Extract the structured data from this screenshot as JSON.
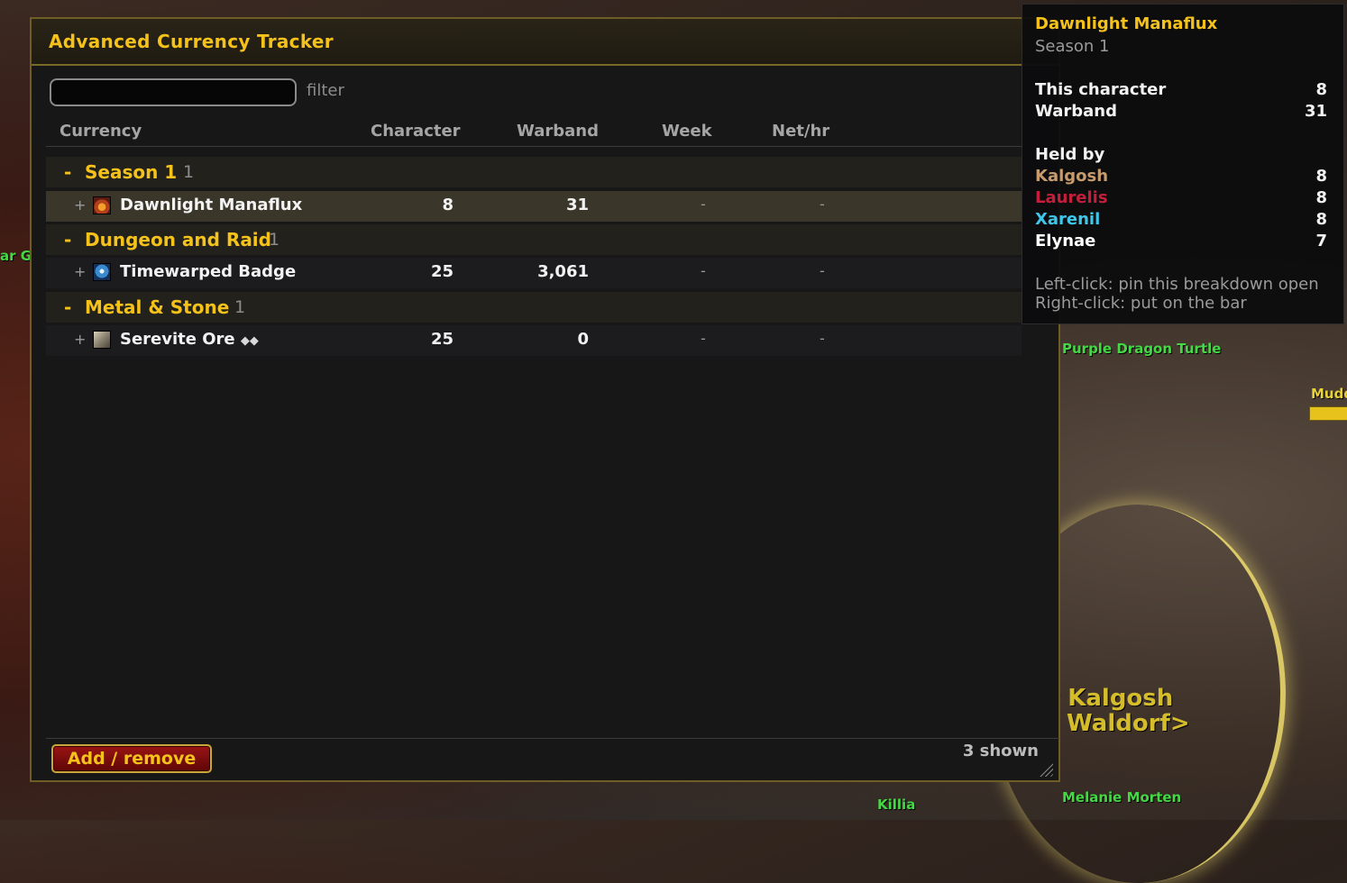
{
  "window": {
    "title": "Advanced Currency Tracker",
    "filter_label": "filter",
    "filter_value": "",
    "columns": [
      "Currency",
      "Character",
      "Warband",
      "Week",
      "Net/hr"
    ],
    "categories": [
      {
        "name": "Season 1",
        "count": "1",
        "items": [
          {
            "name": "Dawnlight Manaflux",
            "character": "8",
            "warband": "31",
            "week": "-",
            "net": "-",
            "icon": "manaflux-icon"
          }
        ]
      },
      {
        "name": "Dungeon and Raid",
        "count": "1",
        "items": [
          {
            "name": "Timewarped Badge",
            "character": "25",
            "warband": "3,061",
            "week": "-",
            "net": "-",
            "icon": "badge-icon"
          }
        ]
      },
      {
        "name": "Metal & Stone",
        "count": "1",
        "items": [
          {
            "name": "Serevite Ore",
            "quality": "◆◆",
            "character": "25",
            "warband": "0",
            "week": "-",
            "net": "-",
            "icon": "ore-icon"
          }
        ]
      }
    ],
    "add_button": "Add / remove",
    "shown_count": "3 shown"
  },
  "tooltip": {
    "title": "Dawnlight Manaflux",
    "subtitle": "Season 1",
    "this_character_label": "This character",
    "this_character_value": "8",
    "warband_label": "Warband",
    "warband_value": "31",
    "held_by_label": "Held by",
    "holders": [
      {
        "name": "Kalgosh",
        "value": "8",
        "color": "#c69b6d"
      },
      {
        "name": "Laurelis",
        "value": "8",
        "color": "#c41e3a"
      },
      {
        "name": "Xarenil",
        "value": "8",
        "color": "#3fc7eb"
      },
      {
        "name": "Elynae",
        "value": "7",
        "color": "#ffffff"
      }
    ],
    "hint_left": "Left-click: pin this breakdown open",
    "hint_right": "Right-click: put on the bar"
  },
  "world": {
    "nameplates": [
      "Purple Dragon Turtle",
      "Mudd",
      "Killia",
      "Melanie Morten",
      "ar Gr"
    ],
    "npc_name": "Ambassador Kalgosh",
    "npc_title": "<Statler and Waldorf>"
  },
  "colors": {
    "accent_gold": "#f4c21a",
    "selected_row": "#3a3629",
    "add_button_red": "#8a1010"
  }
}
